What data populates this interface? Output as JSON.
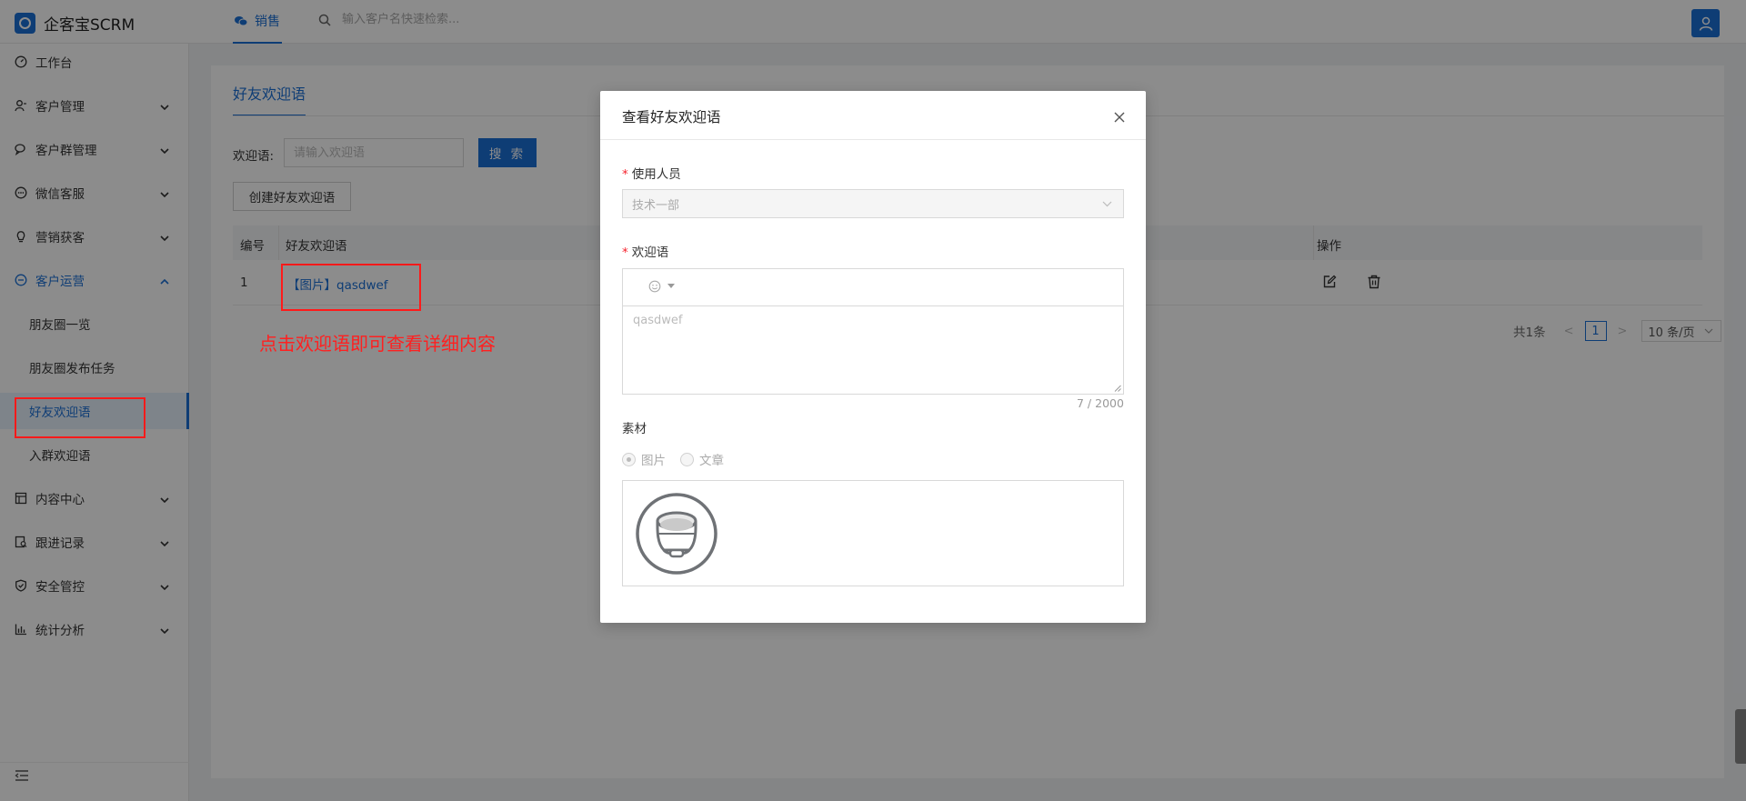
{
  "app": {
    "name": "企客宝SCRM"
  },
  "topbar": {
    "active_tab": "销售",
    "search_placeholder": "输入客户名快速检索..."
  },
  "sidebar": {
    "items": [
      {
        "label": "工作台",
        "icon": "dashboard-icon",
        "has_arrow": false
      },
      {
        "label": "客户管理",
        "icon": "customer-icon",
        "has_arrow": true
      },
      {
        "label": "客户群管理",
        "icon": "chat-group-icon",
        "has_arrow": true
      },
      {
        "label": "微信客服",
        "icon": "wechat-service-icon",
        "has_arrow": true
      },
      {
        "label": "营销获客",
        "icon": "bulb-icon",
        "has_arrow": true
      },
      {
        "label": "客户运营",
        "icon": "operation-icon",
        "has_arrow": true,
        "open": true
      },
      {
        "label": "内容中心",
        "icon": "content-icon",
        "has_arrow": true
      },
      {
        "label": "跟进记录",
        "icon": "record-icon",
        "has_arrow": true
      },
      {
        "label": "安全管控",
        "icon": "shield-icon",
        "has_arrow": true
      },
      {
        "label": "统计分析",
        "icon": "chart-icon",
        "has_arrow": true
      }
    ],
    "sub_items": [
      {
        "label": "朋友圈一览"
      },
      {
        "label": "朋友圈发布任务"
      },
      {
        "label": "好友欢迎语",
        "active": true
      },
      {
        "label": "入群欢迎语"
      }
    ]
  },
  "page": {
    "tab": "好友欢迎语",
    "filter_label": "欢迎语:",
    "filter_placeholder": "请输入欢迎语",
    "search_button": "搜 索",
    "create_button": "创建好友欢迎语",
    "table": {
      "headers": [
        "编号",
        "好友欢迎语",
        "操作"
      ],
      "rows": [
        {
          "id": "1",
          "content": "【图片】qasdwef"
        }
      ]
    },
    "pagination": {
      "total": "共1条",
      "current": "1",
      "page_size": "10 条/页"
    },
    "annotation": "点击欢迎语即可查看详细内容"
  },
  "dialog": {
    "title": "查看好友欢迎语",
    "user_label": "使用人员",
    "user_value": "技术一部",
    "welcome_label": "欢迎语",
    "welcome_text": "qasdwef",
    "char_count": "7 / 2000",
    "material_label": "素材",
    "material_options": [
      "图片",
      "文章"
    ],
    "material_selected": "图片"
  },
  "colors": {
    "primary": "#1b6fd6",
    "annotation": "#ff1a1a",
    "overlay": "rgba(0,0,0,0.45)"
  }
}
